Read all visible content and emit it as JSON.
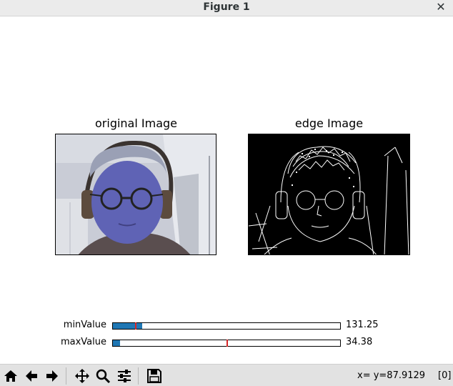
{
  "window": {
    "title": "Figure 1"
  },
  "axes": [
    {
      "title": "original Image"
    },
    {
      "title": "edge Image"
    }
  ],
  "sliders": [
    {
      "label": "minValue",
      "value_text": "131.25",
      "fill_fraction": 0.13,
      "marker_fraction": 0.1
    },
    {
      "label": "maxValue",
      "value_text": "34.38",
      "fill_fraction": 0.03,
      "marker_fraction": 0.5
    }
  ],
  "toolbar": {
    "icons": [
      "home-icon",
      "back-arrow-icon",
      "forward-arrow-icon",
      "pan-icon",
      "zoom-icon",
      "configure-subplots-icon",
      "save-icon"
    ]
  },
  "status": {
    "coords": "x= y=87.9129",
    "pixel": "[0]"
  },
  "colors": {
    "slider_fill": "#1f77b4",
    "slider_marker": "#d62728",
    "toolbar_bg": "#e2e2e2"
  }
}
